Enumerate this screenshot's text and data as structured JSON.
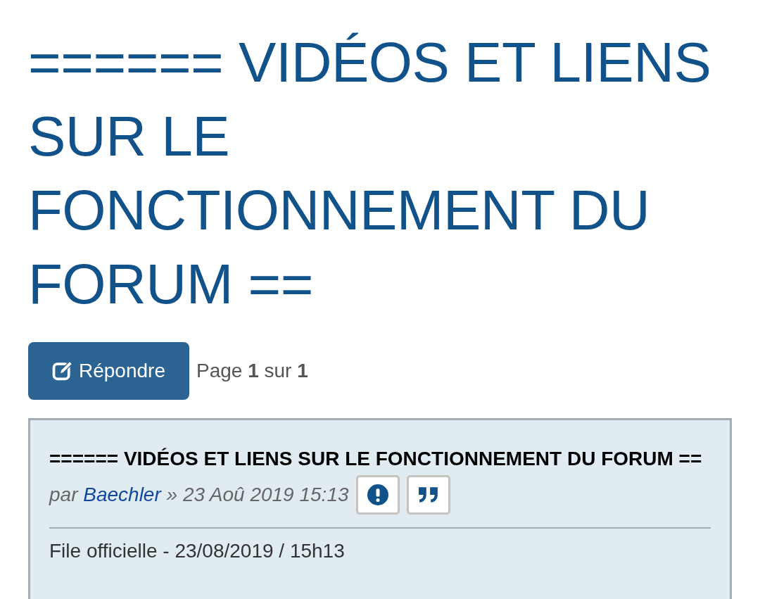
{
  "topic_title": "====== VIDÉOS ET LIENS SUR LE FONCTIONNEMENT DU FORUM ==",
  "reply_button": {
    "label": "Répondre"
  },
  "pagination": "Page **1** sur **1**",
  "post": {
    "title": "====== VIDÉOS ET LIENS SUR LE FONCTIONNEMENT DU FORUM ==",
    "by": "par",
    "author": "Baechler",
    "date": "» 23 Aoû 2019 15:13",
    "actions": [
      {
        "kind": "report"
      },
      {
        "kind": "quote"
      }
    ],
    "body": "File officielle - 23/08/2019 / 15h13"
  }
}
